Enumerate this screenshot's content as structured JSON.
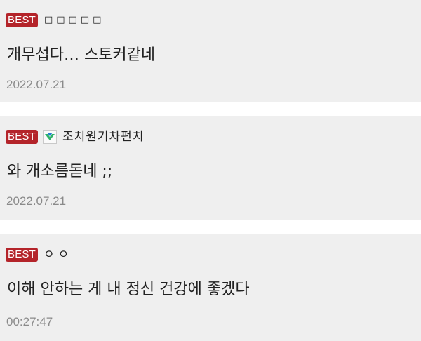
{
  "comments": [
    {
      "badge": "BEST",
      "nickname": "□□□□□",
      "text": "개무섭다… 스토커같네",
      "time": "2022.07.21",
      "has_level_icon": false
    },
    {
      "badge": "BEST",
      "nickname": "조치원기차펀치",
      "text": "와 개소름돋네 ;;",
      "time": "2022.07.21",
      "has_level_icon": true,
      "level_icon": "green-chevron-level-icon"
    },
    {
      "badge": "BEST",
      "nickname": "ㅇㅇ",
      "text": "이해 안하는 게 내 정신 건강에 좋겠다",
      "time": "00:27:47",
      "has_level_icon": false
    }
  ],
  "colors": {
    "badge_bg": "#b4242a",
    "card_bg": "#efefef",
    "timestamp": "#8a8a8a",
    "text": "#222222"
  }
}
